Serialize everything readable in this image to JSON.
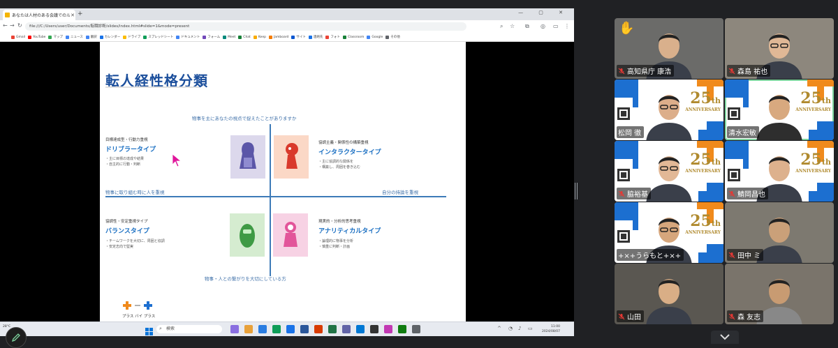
{
  "browser": {
    "tab_title": "あなたは人材のある会議でのルール共有にて...",
    "new_tab": "+",
    "window_controls": "— ▢ ✕",
    "url": "file:///C:/Users/user/Documents/転職診断/slides/index.html#slide=1&mode=present",
    "bookmarks": [
      "Gmail",
      "YouTube",
      "マップ",
      "ニュース",
      "翻訳",
      "カレンダー",
      "ドライブ",
      "スプレッドシート",
      "ドキュメント",
      "フォーム",
      "Meet",
      "Chat",
      "Keep",
      "Jamboard",
      "サイト",
      "連絡先",
      "フォト",
      "Classroom",
      "Google",
      "その他"
    ]
  },
  "slide": {
    "title": "転人経性格分類",
    "axis_top": "物事を主にあなたの視点で捉えたことがありますか",
    "axis_bottom": "物事・人との繋がりを大切にしている方",
    "axis_left": "物事に取り組む時に人を重視",
    "axis_right": "自分の持論を重視",
    "quadrants": [
      {
        "top": "目標達成型・行動力重視",
        "type": "ドリブラータイプ",
        "desc1": "・主に目標の達成や結果",
        "desc2": "・自主的に行動・判断"
      },
      {
        "top": "協調主義・関係性の構築重視",
        "type": "インタラクタータイプ",
        "desc1": "・主に協調的な関係を",
        "desc2": "・構築し、周囲を巻き込む"
      },
      {
        "top": "協調性・安定重視タイプ",
        "type": "バランスタイプ",
        "desc1": "・チームワークを大切に、周囲と協調",
        "desc2": "・安定志向で堅実"
      },
      {
        "top": "現実的・分析的思考重視",
        "type": "アナリティカルタイプ",
        "desc1": "・論理的に物事を分析",
        "desc2": "・慎重に判断・計画"
      }
    ],
    "logo_text": "プラス バイ プラス"
  },
  "taskbar": {
    "weather": "28°C",
    "search_placeholder": "検索",
    "time": "11:00",
    "date": "2024/08/07"
  },
  "participants": [
    {
      "name": "高知県庁 康浩",
      "muted": true,
      "raised_hand": true
    },
    {
      "name": "森島 祐也",
      "muted": true
    },
    {
      "name": "松岡 徹",
      "muted": false
    },
    {
      "name": "清水宏敏",
      "muted": false,
      "speaking": true
    },
    {
      "name": "脇裕基",
      "muted": true
    },
    {
      "name": "鯖岡昌也",
      "muted": true
    },
    {
      "name": "+×+うらもと+×+",
      "muted": false
    },
    {
      "name": "田中 ミ",
      "muted": true
    },
    {
      "name": "山田",
      "muted": true
    },
    {
      "name": "森 友志",
      "muted": true
    }
  ],
  "anniversary": {
    "number": "25",
    "suffix": "th",
    "word": "ANNIVERSARY"
  },
  "colors": {
    "brand_blue": "#1c4f9c",
    "accent_orange": "#f08a1c",
    "speaking_outline": "#7fd6a0",
    "mic_off": "#e53935"
  }
}
